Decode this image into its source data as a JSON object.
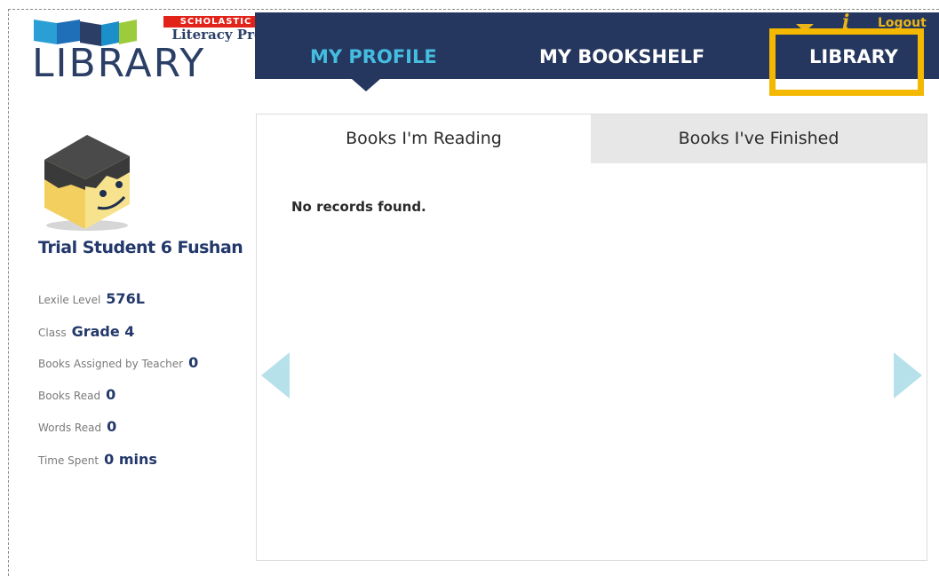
{
  "logo": {
    "brand": "SCHOLASTIC",
    "product": "Literacy Pro",
    "trademark": "™",
    "word": "LIBRARY"
  },
  "nav": {
    "items": [
      {
        "label": "MY PROFILE",
        "active": true
      },
      {
        "label": "MY BOOKSHELF",
        "active": false
      },
      {
        "label": "LIBRARY",
        "active": false,
        "highlighted": true
      }
    ],
    "logout_label": "Logout"
  },
  "profile": {
    "name": "Trial Student 6 Fushan",
    "stats": [
      {
        "label": "Lexile Level",
        "value": "576L"
      },
      {
        "label": "Class",
        "value": "Grade 4"
      },
      {
        "label": "Books Assigned by Teacher",
        "value": "0"
      },
      {
        "label": "Books Read",
        "value": "0"
      },
      {
        "label": "Words Read",
        "value": "0"
      },
      {
        "label": "Time Spent",
        "value": "0 mins"
      }
    ]
  },
  "panel": {
    "tabs": [
      {
        "label": "Books I'm Reading",
        "active": true
      },
      {
        "label": "Books I've Finished",
        "active": false
      }
    ],
    "empty_message": "No records found."
  },
  "colors": {
    "nav_bg": "#25375e",
    "accent_blue": "#45bde0",
    "highlight": "#f5b800",
    "arrow": "#b7e1ea"
  }
}
